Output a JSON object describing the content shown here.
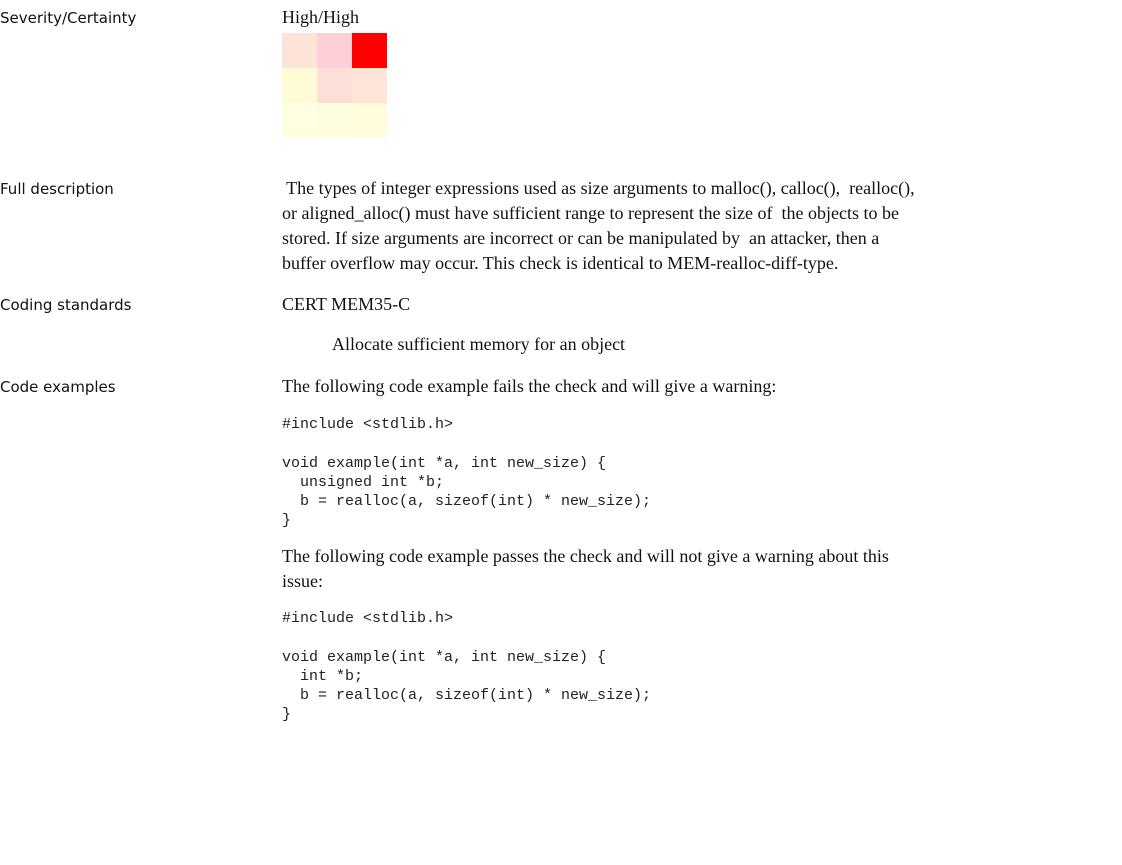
{
  "severity": {
    "label": "Severity/Certainty",
    "value": "High/High",
    "matrix_colors": [
      [
        "#fde3d8",
        "#fcd0d4",
        "#ff0000"
      ],
      [
        "#fffbd6",
        "#fce0d8",
        "#fde5d8"
      ],
      [
        "#fffee0",
        "#fffde0",
        "#fffddc"
      ]
    ]
  },
  "full_description": {
    "label": "Full description",
    "lines": [
      " The types of integer expressions used as size arguments to malloc(), calloc(),  realloc(),",
      "or aligned_alloc() must have sufficient range to represent the size of  the objects to be",
      "stored. If size arguments are incorrect or can be manipulated by  an attacker, then a",
      "buffer overflow may occur. This check is identical to MEM-realloc-diff-type."
    ]
  },
  "coding_standards": {
    "label": "Coding standards",
    "standard": "CERT MEM35-C",
    "detail": "Allocate sufficient memory for an object"
  },
  "code_examples": {
    "label": "Code examples",
    "fail_intro": "The following code example fails the check and will give a warning:",
    "fail_code": [
      "#include <stdlib.h>",
      "",
      "void example(int *a, int new_size) {",
      "  unsigned int *b;",
      "  b = realloc(a, sizeof(int) * new_size);",
      "}"
    ],
    "pass_intro": [
      "The following code example passes the check and will not give a warning about this",
      "issue:"
    ],
    "pass_code": [
      "#include <stdlib.h>",
      "",
      "void example(int *a, int new_size) {",
      "  int *b;",
      "  b = realloc(a, sizeof(int) * new_size);",
      "}"
    ]
  }
}
